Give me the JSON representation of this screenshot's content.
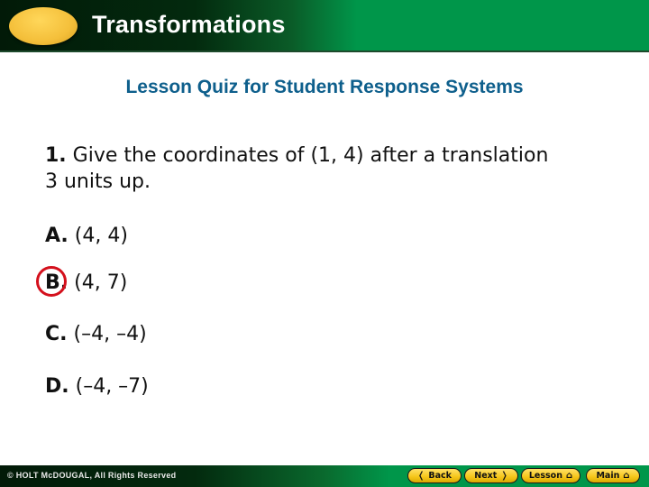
{
  "header": {
    "title": "Transformations"
  },
  "subtitle": "Lesson Quiz for Student Response Systems",
  "question": {
    "number": "1.",
    "text_line1": " Give the coordinates of (1, 4) after a translation",
    "text_line2": "3 units up."
  },
  "choices": [
    {
      "letter": "A.",
      "value": " (4, 4)",
      "selected": false
    },
    {
      "letter": "B.",
      "value": " (4, 7)",
      "selected": true
    },
    {
      "letter": "C.",
      "value": " (–4, –4)",
      "selected": false
    },
    {
      "letter": "D.",
      "value": " (–4, –7)",
      "selected": false
    }
  ],
  "footer": {
    "copyright": "© HOLT McDOUGAL, All Rights Reserved",
    "nav": {
      "back": "Back",
      "next": "Next",
      "lesson": "Lesson",
      "main": "Main"
    }
  },
  "colors": {
    "header_green": "#00964a",
    "title_blue": "#0e5f8c",
    "answer_circle_red": "#d4101c",
    "button_yellow": "#f5c518"
  }
}
